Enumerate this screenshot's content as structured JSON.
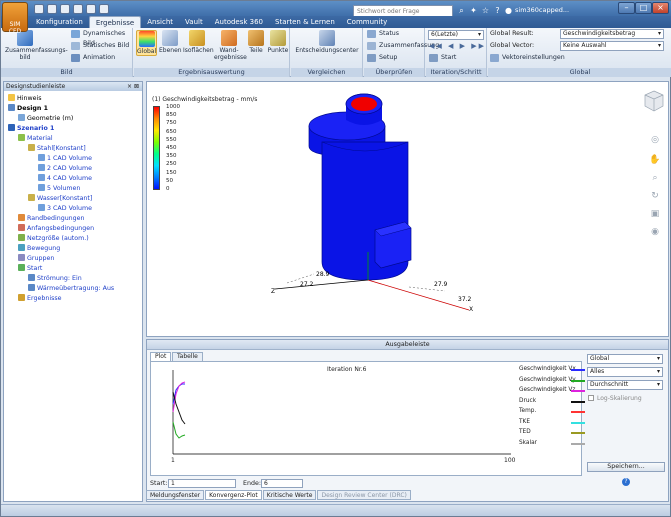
{
  "app": {
    "logo_text": "SIM CFD",
    "user": "sim360capped..."
  },
  "title_search": {
    "placeholder": "Stichwort oder Frage eingeben"
  },
  "tabs": [
    "Konfiguration",
    "Ergebnisse",
    "Ansicht",
    "Vault",
    "Autodesk 360",
    "Starten & Lernen",
    "Community"
  ],
  "active_tab": "Ergebnisse",
  "ribbon": {
    "bild": {
      "label": "Bild",
      "zusammenfassungsbild": "Zusammenfassungs-bild",
      "dynamisches_bild": "Dynamisches Bild",
      "statisches_bild": "Statisches Bild",
      "animation": "Animation"
    },
    "auswertung": {
      "label": "Ergebnisauswertung",
      "global": "Global",
      "ebenen": "Ebenen",
      "isoflaechen": "Isoflächen",
      "wandergebnisse": "Wand-ergebnisse",
      "teile": "Teile",
      "punkte": "Punkte"
    },
    "vergleichen": {
      "label": "Vergleichen",
      "entscheidungscenter": "Entscheidungscenter"
    },
    "ueberpruefen": {
      "label": "Überprüfen",
      "status": "Status",
      "zusammenfassung": "Zusammenfassung",
      "setup": "Setup"
    },
    "iteration": {
      "label": "Iteration/Schritt",
      "value": "6(Letzte)",
      "start": "Start"
    },
    "global": {
      "label": "Global",
      "result_label": "Global Result:",
      "result_value": "Geschwindigkeitsbetrag",
      "vector_label": "Global Vector:",
      "vector_value": "Keine Auswahl",
      "vektoreinstellungen": "Vektoreinstellungen"
    }
  },
  "left_panel": {
    "title": "Designstudienleiste",
    "tree": [
      {
        "label": "Hinweis",
        "icon": "info-icon",
        "color": "#000000",
        "bold": false
      },
      {
        "label": "Design 1",
        "icon": "design-icon",
        "color": "#000000",
        "bold": true
      },
      {
        "label": "Geometrie (m)",
        "icon": "geometry-icon",
        "color": "#000000",
        "bold": false
      },
      {
        "label": "Szenario 1",
        "icon": "scenario-icon",
        "color": "#1e3fc8",
        "bold": true
      },
      {
        "label": "Material",
        "icon": "material-icon",
        "color": "#1e3fc8",
        "bold": false
      },
      {
        "label": "Stahl[Konstant]",
        "icon": "steel-icon",
        "color": "#1e3fc8",
        "bold": false
      },
      {
        "label": "1 CAD Volume",
        "icon": "volume-icon",
        "color": "#1e3fc8",
        "bold": false
      },
      {
        "label": "2 CAD Volume",
        "icon": "volume-icon",
        "color": "#1e3fc8",
        "bold": false
      },
      {
        "label": "4 CAD Volume",
        "icon": "volume-icon",
        "color": "#1e3fc8",
        "bold": false
      },
      {
        "label": "5 Volumen",
        "icon": "volume-icon",
        "color": "#1e3fc8",
        "bold": false
      },
      {
        "label": "Wasser[Konstant]",
        "icon": "water-icon",
        "color": "#1e3fc8",
        "bold": false
      },
      {
        "label": "3 CAD Volume",
        "icon": "volume-icon",
        "color": "#1e3fc8",
        "bold": false
      },
      {
        "label": "Randbedingungen",
        "icon": "boundary-icon",
        "color": "#1e3fc8",
        "bold": false
      },
      {
        "label": "Anfangsbedingungen",
        "icon": "initial-icon",
        "color": "#1e3fc8",
        "bold": false
      },
      {
        "label": "Netzgröße (autom.)",
        "icon": "mesh-icon",
        "color": "#1e3fc8",
        "bold": false
      },
      {
        "label": "Bewegung",
        "icon": "motion-icon",
        "color": "#1e3fc8",
        "bold": false
      },
      {
        "label": "Gruppen",
        "icon": "groups-icon",
        "color": "#1e3fc8",
        "bold": false
      },
      {
        "label": "Start",
        "icon": "start-icon",
        "color": "#1e3fc8",
        "bold": false
      },
      {
        "label": "Strömung: Ein",
        "icon": "flow-icon",
        "color": "#1e3fc8",
        "bold": false
      },
      {
        "label": "Wärmeübertragung: Aus",
        "icon": "heat-icon",
        "color": "#1e3fc8",
        "bold": false
      },
      {
        "label": "Ergebnisse",
        "icon": "results-icon",
        "color": "#1e3fc8",
        "bold": false
      }
    ]
  },
  "viewport": {
    "legend_title": "(1) Geschwindigkeitsbetrag - mm/s",
    "legend_ticks": [
      "1000",
      "850",
      "750",
      "650",
      "550",
      "450",
      "350",
      "250",
      "150",
      "50",
      "0"
    ],
    "axis_labels": {
      "a": "28.9",
      "b": "27.2",
      "c": "27.9",
      "d": "37.2",
      "x": "X",
      "z": "Z"
    }
  },
  "output": {
    "title": "Ausgabeleiste",
    "tabs": [
      "Plot",
      "Tabelle"
    ],
    "plot_title": "Iteration Nr.6",
    "x_ticks": [
      "1",
      "100"
    ],
    "legend": [
      {
        "name": "Geschwindigkeit Vx",
        "color": "#2b2bff"
      },
      {
        "name": "Geschwindigkeit Vy",
        "color": "#22aa22"
      },
      {
        "name": "Geschwindigkeit Vz",
        "color": "#dd22dd"
      },
      {
        "name": "Druck",
        "color": "#111111"
      },
      {
        "name": "Temp.",
        "color": "#ff3333"
      },
      {
        "name": "TKE",
        "color": "#33e0e0"
      },
      {
        "name": "TED",
        "color": "#9a9a22"
      },
      {
        "name": "Skalar",
        "color": "#aaaaaa"
      }
    ],
    "start_label": "Start:",
    "start_value": "1",
    "end_label": "Ende:",
    "end_value": "6",
    "dropdowns": [
      "Global",
      "Alles",
      "Durchschnitt"
    ],
    "log_label": "Log-Skalierung",
    "save": "Speichern..."
  },
  "bottom_tabs": [
    "Meldungsfenster",
    "Konvergenz-Plot",
    "Kritische Werte",
    "Design Review Center (DRC)"
  ]
}
